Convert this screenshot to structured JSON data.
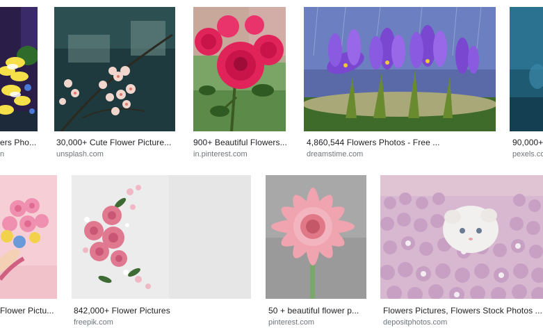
{
  "results": [
    {
      "title": "ers Pho...",
      "source": "n",
      "image": "flower-image"
    },
    {
      "title": "30,000+ Cute Flower Picture...",
      "source": "unsplash.com",
      "image": "flower-image"
    },
    {
      "title": "900+ Beautiful Flowers...",
      "source": "in.pinterest.com",
      "image": "rose-image"
    },
    {
      "title": "4,860,544 Flowers Photos - Free ...",
      "source": "dreamstime.com",
      "image": "crocus-image"
    },
    {
      "title": "90,000+",
      "source": "pexels.co",
      "image": "flower-image"
    },
    {
      "title": "Flower Pictu...",
      "source": "",
      "image": "bouquet-image"
    },
    {
      "title": "842,000+ Flower Pictures",
      "source": "freepik.com",
      "image": "rose-wreath-image"
    },
    {
      "title": "50 + beautiful flower p...",
      "source": "pinterest.com",
      "image": "gerbera-image"
    },
    {
      "title": "Flowers Pictures, Flowers Stock Photos ...",
      "source": "depositphotos.com",
      "image": "kitten-flowers-image"
    }
  ]
}
